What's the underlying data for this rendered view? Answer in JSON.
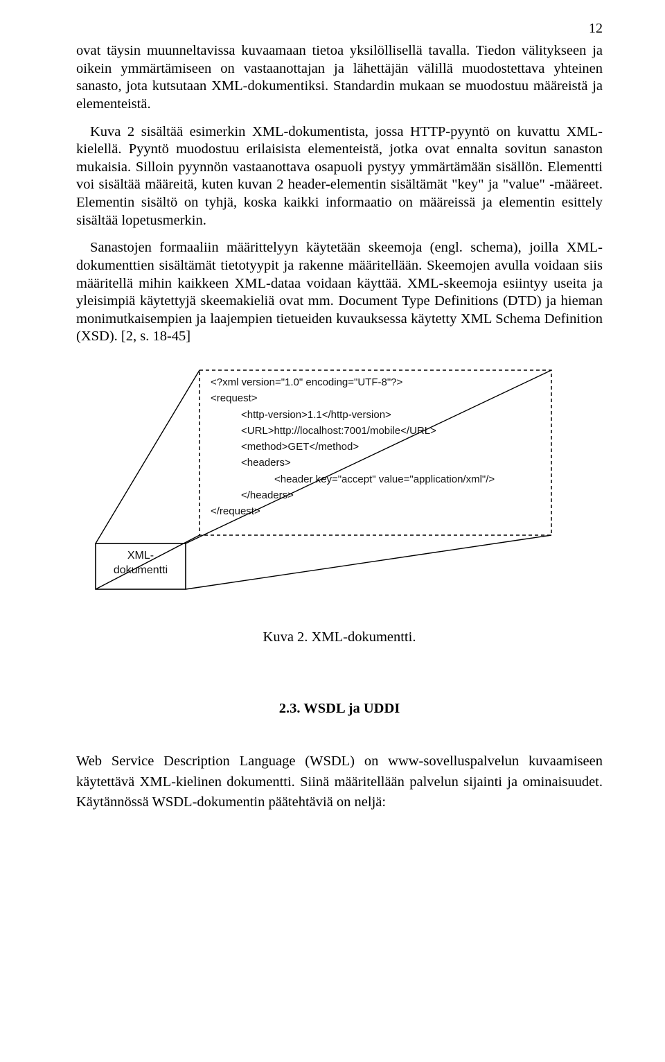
{
  "page_number": "12",
  "para1": "ovat täysin muunneltavissa kuvaamaan tietoa yksilöllisellä tavalla. Tiedon välitykseen ja oikein ymmärtämiseen on vastaanottajan ja lähettäjän välillä muodostettava yhteinen sanasto, jota kutsutaan XML-dokumentiksi. Standardin mukaan se muodostuu määreistä ja elementeistä.",
  "para2": "Kuva 2 sisältää esimerkin XML-dokumentista, jossa HTTP-pyyntö on kuvattu XML-kielellä. Pyyntö muodostuu erilaisista elementeistä, jotka ovat ennalta sovitun sanaston mukaisia. Silloin pyynnön vastaanottava osapuoli pystyy ymmärtämään sisällön. Elementti voi sisältää määreitä, kuten kuvan 2 header-elementin sisältämät \"key\" ja \"value\" -määreet. Elementin sisältö on tyhjä, koska kaikki informaatio on määreissä ja elementin esittely sisältää lopetusmerkin.",
  "para3": "Sanastojen formaaliin määrittelyyn käytetään skeemoja (engl. schema), joilla XML-dokumenttien sisältämät tietotyypit ja rakenne määritellään. Skeemojen avulla voidaan siis määritellä mihin kaikkeen XML-dataa voidaan käyttää. XML-skeemoja esiintyy useita ja yleisimpiä käytettyjä skeemakieliä ovat mm. Document Type Definitions (DTD) ja hieman monimutkaisempien ja laajempien tietueiden kuvauksessa käytetty XML Schema Definition (XSD). [2, s. 18-45]",
  "code": {
    "l1": "<?xml version=\"1.0\" encoding=\"UTF-8\"?>",
    "l2": "<request>",
    "l3": "<http-version>1.1</http-version>",
    "l4": "<URL>http://localhost:7001/mobile</URL>",
    "l5": "<method>GET</method>",
    "l6": "<headers>",
    "l7": "<header key=\"accept\" value=\"application/xml\"/>",
    "l8": "</headers>",
    "l9": "</request>"
  },
  "label_box_line1": "XML-",
  "label_box_line2": "dokumentti",
  "caption": "Kuva 2. XML-dokumentti.",
  "subheading": "2.3. WSDL ja UDDI",
  "last_para": "Web Service Description Language (WSDL) on www-sovelluspalvelun kuvaamiseen käytettävä XML-kielinen dokumentti. Siinä määritellään palvelun sijainti ja ominaisuudet. Käytännössä WSDL-dokumentin päätehtäviä on neljä:"
}
